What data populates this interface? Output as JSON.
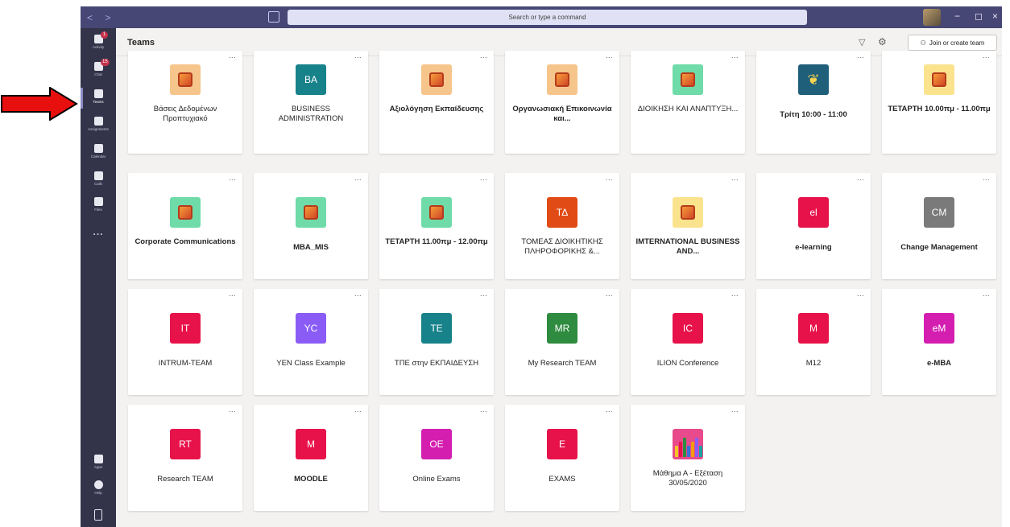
{
  "titlebar": {
    "search_placeholder": "Search or type a command",
    "nav": "< >",
    "minimize": "−",
    "restore": "◻",
    "close": "×"
  },
  "rail": {
    "items": [
      {
        "label": "Activity",
        "badge": "1"
      },
      {
        "label": "Chat",
        "badge": "15"
      },
      {
        "label": "Teams"
      },
      {
        "label": "Assignments"
      },
      {
        "label": "Calendar"
      },
      {
        "label": "Calls"
      },
      {
        "label": "Files"
      },
      {
        "label": "..."
      }
    ],
    "bottom": [
      {
        "label": "Apps"
      },
      {
        "label": "Help"
      }
    ]
  },
  "header": {
    "title": "Teams",
    "join_label": "Join or create team"
  },
  "teams": [
    {
      "name": "Βάσεις Δεδομένων Προπτυχιακό",
      "icon": "office-icon",
      "bg": "#f6c58b",
      "bold": false
    },
    {
      "name": "BUSINESS ADMINISTRATION",
      "initials": "BA",
      "bg": "#17828a",
      "bold": false
    },
    {
      "name": "Αξιολόγηση Εκπαίδευσης",
      "icon": "office-icon",
      "bg": "#f6c58b",
      "bold": true
    },
    {
      "name": "Οργανωσιακή Επικοινωνία και...",
      "icon": "office-icon",
      "bg": "#f6c58b",
      "bold": true
    },
    {
      "name": "ΔΙΟΙΚΗΣΗ ΚΑΙ ΑΝΑΠΤΥΞΗ...",
      "icon": "office-icon",
      "bg": "#6fdba8",
      "bold": false
    },
    {
      "name": "Τρίτη 10:00 - 11:00",
      "icon": "laurel-icon",
      "bg": "#1f5f7a",
      "bold": true
    },
    {
      "name": "ΤΕΤΑΡΤΗ 10.00πμ - 11.00πμ",
      "icon": "office-icon",
      "bg": "#fbe38e",
      "bold": true
    },
    {
      "name": "Corporate Communications",
      "icon": "office-icon",
      "bg": "#6fdba8",
      "bold": true
    },
    {
      "name": "MBA_MIS",
      "icon": "office-icon",
      "bg": "#6fdba8",
      "bold": true
    },
    {
      "name": "ΤΕΤΑΡΤΗ 11.00πμ - 12.00πμ",
      "icon": "office-icon",
      "bg": "#6fdba8",
      "bold": true
    },
    {
      "name": "ΤΟΜΕΑΣ ΔΙΟΙΚΗΤΙΚΗΣ ΠΛΗΡΟΦΟΡΙΚΗΣ &...",
      "initials": "ΤΔ",
      "bg": "#e14b16",
      "bold": false
    },
    {
      "name": "IMTERNATIONAL BUSINESS AND...",
      "icon": "office-icon",
      "bg": "#fbe38e",
      "bold": true
    },
    {
      "name": "e-learning",
      "initials": "el",
      "bg": "#e8124a",
      "bold": true
    },
    {
      "name": "Change Management",
      "initials": "CM",
      "bg": "#7a7a7a",
      "bold": true
    },
    {
      "name": "INTRUM-TEAM",
      "initials": "IT",
      "bg": "#e8124a",
      "bold": false
    },
    {
      "name": "YEN Class Example",
      "initials": "YC",
      "bg": "#8a5cf5",
      "bold": false
    },
    {
      "name": "ΤΠΕ στην ΕΚΠΑΙΔΕΥΣΗ",
      "initials": "TE",
      "bg": "#17828a",
      "bold": false
    },
    {
      "name": "My Research TEAM",
      "initials": "MR",
      "bg": "#2e8b3f",
      "bold": false
    },
    {
      "name": "ILION Conference",
      "initials": "IC",
      "bg": "#e8124a",
      "bold": false
    },
    {
      "name": "M12",
      "initials": "M",
      "bg": "#e8124a",
      "bold": false
    },
    {
      "name": "e-MBA",
      "initials": "eM",
      "bg": "#d41eb0",
      "bold": true
    },
    {
      "name": "Research TEAM",
      "initials": "RT",
      "bg": "#e8124a",
      "bold": false
    },
    {
      "name": "MOODLE",
      "initials": "M",
      "bg": "#e8124a",
      "bold": true
    },
    {
      "name": "Online Exams",
      "initials": "OE",
      "bg": "#d41eb0",
      "bold": false
    },
    {
      "name": "EXAMS",
      "initials": "E",
      "bg": "#e8124a",
      "bold": false
    },
    {
      "name": "Μάθημα Α - Εξέταση 30/05/2020",
      "icon": "pencils-icon",
      "bg": "#e84a8b",
      "bold": false
    }
  ],
  "card_more": "..."
}
